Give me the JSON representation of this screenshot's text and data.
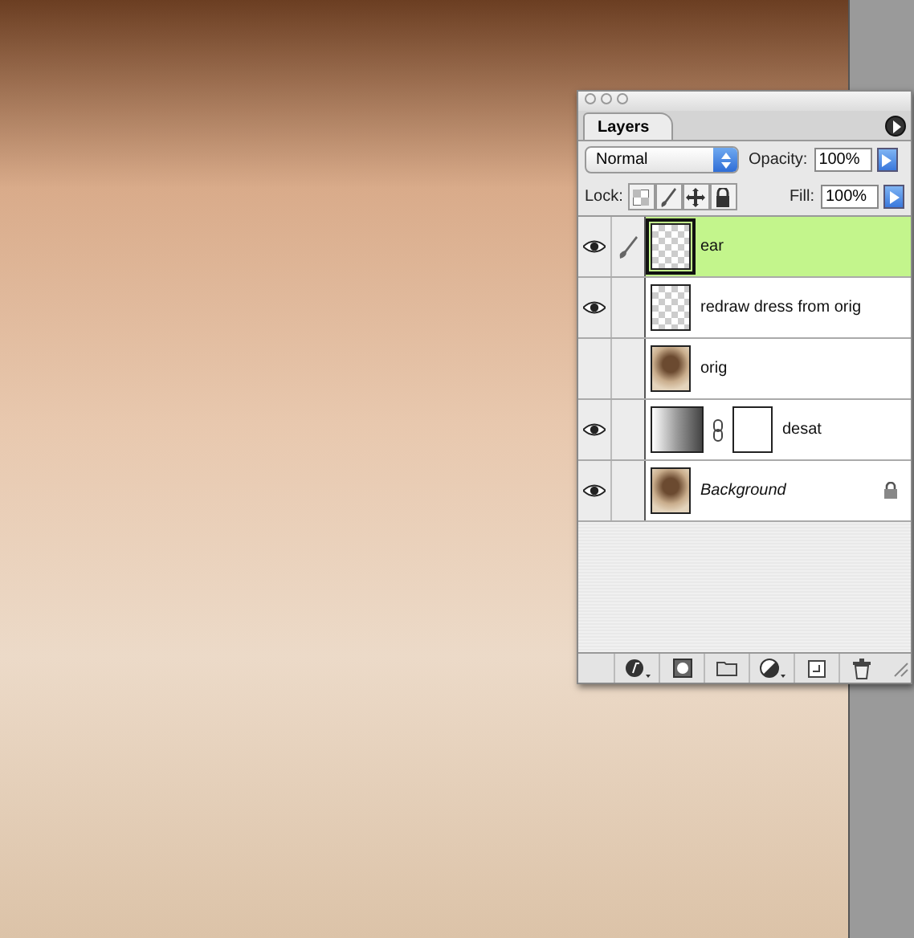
{
  "panel": {
    "tab": "Layers",
    "blend_mode": "Normal",
    "opacity_label": "Opacity:",
    "opacity": "100%",
    "lock_label": "Lock:",
    "fill_label": "Fill:",
    "fill": "100%"
  },
  "layers": [
    {
      "name": "ear",
      "kind": "pixel",
      "thumbnail": {
        "kind": "transparent"
      },
      "mask": false,
      "selected": true,
      "visible": true,
      "brush": true,
      "locked": false
    },
    {
      "name": "redraw dress from orig",
      "kind": "pixel",
      "thumbnail": {
        "kind": "transparent"
      },
      "mask": false,
      "selected": false,
      "visible": true,
      "brush": false,
      "locked": false
    },
    {
      "name": "orig",
      "kind": "pixel",
      "thumbnail": {
        "kind": "photo"
      },
      "mask": false,
      "selected": false,
      "visible": false,
      "brush": false,
      "locked": false
    },
    {
      "name": "desat",
      "kind": "adjustment",
      "thumbnail": {
        "kind": "gradient"
      },
      "mask": true,
      "selected": false,
      "visible": true,
      "brush": false,
      "locked": false
    },
    {
      "name": "Background",
      "kind": "background",
      "thumbnail": {
        "kind": "photo"
      },
      "mask": false,
      "selected": false,
      "visible": true,
      "brush": false,
      "locked": true
    }
  ]
}
